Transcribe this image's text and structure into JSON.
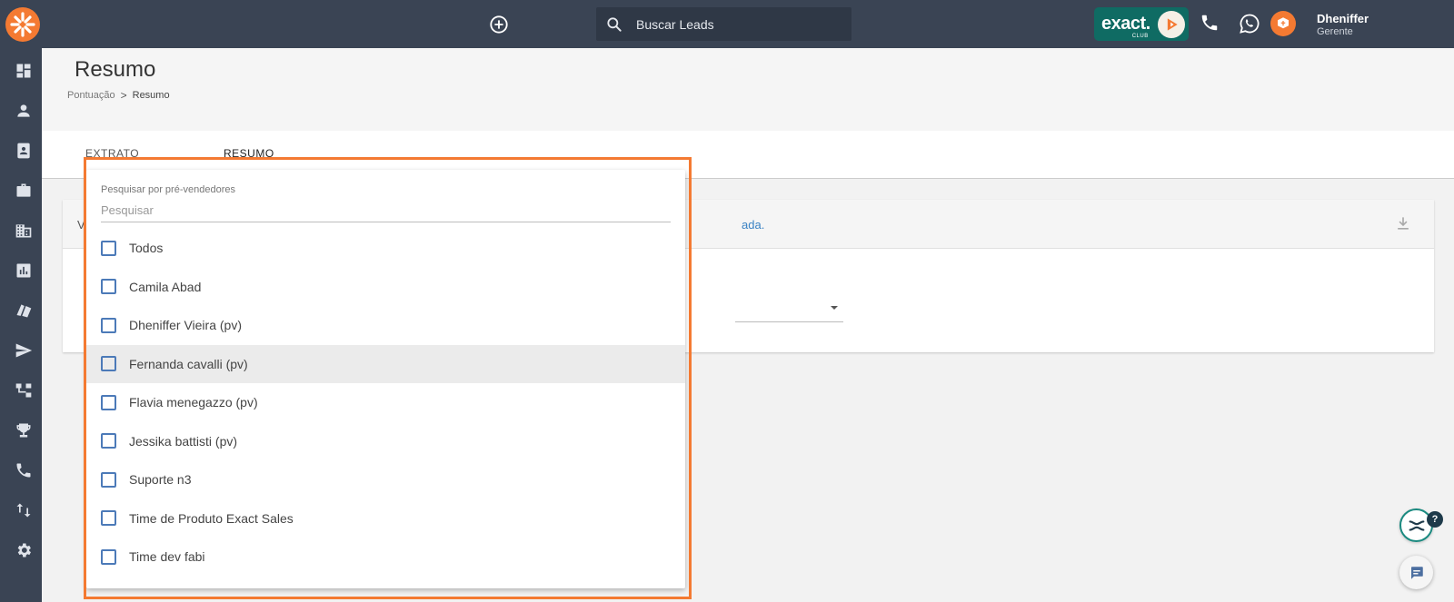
{
  "topbar": {
    "search_placeholder": "Buscar Leads",
    "brand_badge": {
      "text": "exact.",
      "sub": "CLUB"
    },
    "user": {
      "name": "Dheniffer",
      "role": "Gerente"
    },
    "icons": [
      "logo-icon",
      "add-circle-icon",
      "search-icon",
      "phone-icon",
      "whatsapp-icon",
      "notification-icon"
    ]
  },
  "sidebar": {
    "items": [
      {
        "name": "dashboard-icon"
      },
      {
        "name": "person-icon"
      },
      {
        "name": "contacts-icon"
      },
      {
        "name": "briefcase-icon"
      },
      {
        "name": "building-icon"
      },
      {
        "name": "chart-icon"
      },
      {
        "name": "tickets-icon"
      },
      {
        "name": "send-icon"
      },
      {
        "name": "hierarchy-icon"
      },
      {
        "name": "trophy-icon"
      },
      {
        "name": "phone-icon"
      },
      {
        "name": "swap-icon"
      },
      {
        "name": "settings-icon"
      }
    ]
  },
  "page": {
    "title": "Resumo",
    "breadcrumb": {
      "parent": "Pontuação",
      "separator": ">",
      "current": "Resumo"
    }
  },
  "tabs": [
    {
      "label": "EXTRATO"
    },
    {
      "label": "RESUMO"
    }
  ],
  "card": {
    "lead_partial": "V",
    "link_partial": "ada."
  },
  "dropdown": {
    "label": "Pesquisar por pré-vendedores",
    "placeholder": "Pesquisar",
    "options": [
      {
        "label": "Todos",
        "checked": false
      },
      {
        "label": "Camila Abad",
        "checked": false
      },
      {
        "label": "Dheniffer Vieira (pv)",
        "checked": false
      },
      {
        "label": "Fernanda cavalli (pv)",
        "checked": false
      },
      {
        "label": "Flavia menegazzo (pv)",
        "checked": false
      },
      {
        "label": "Jessika battisti (pv)",
        "checked": false
      },
      {
        "label": "Suporte n3",
        "checked": false
      },
      {
        "label": "Time de Produto Exact Sales",
        "checked": false
      },
      {
        "label": "Time dev fabi",
        "checked": false
      }
    ],
    "hovered_index": 3
  },
  "widgets": {
    "help_badge": "?"
  },
  "colors": {
    "topbar": "#3a4454",
    "accent_orange": "#f47a32",
    "brand_teal": "#0f6b63",
    "checkbox_blue": "#4c7ab8",
    "link_blue": "#3b83c4"
  }
}
